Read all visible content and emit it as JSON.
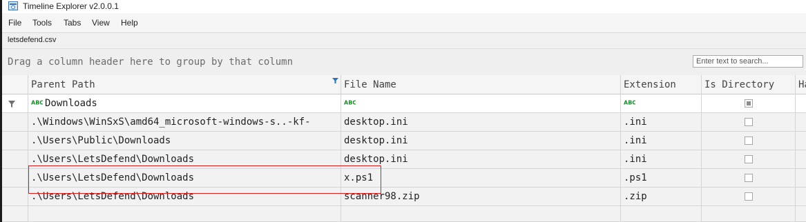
{
  "window": {
    "title": "Timeline Explorer v2.0.0.1",
    "icon": "timeline-app-icon"
  },
  "menu": [
    "File",
    "Tools",
    "Tabs",
    "View",
    "Help"
  ],
  "file_tab": "letsdefend.csv",
  "group_panel": {
    "hint": "Drag a column header here to group by that column",
    "search_placeholder": "Enter text to search..."
  },
  "grid": {
    "columns": [
      "Parent Path",
      "File Name",
      "Extension",
      "Is Directory",
      "Ha"
    ],
    "filter": {
      "parent_path": "Downloads",
      "file_name": "",
      "extension": "",
      "is_directory": "indeterminate"
    },
    "rows": [
      {
        "parent_path": ".\\Windows\\WinSxS\\amd64_microsoft-windows-s..-kf-",
        "file_name": "desktop.ini",
        "extension": ".ini",
        "is_directory": false
      },
      {
        "parent_path": ".\\Users\\Public\\Downloads",
        "file_name": "desktop.ini",
        "extension": ".ini",
        "is_directory": false
      },
      {
        "parent_path": ".\\Users\\LetsDefend\\Downloads",
        "file_name": "desktop.ini",
        "extension": ".ini",
        "is_directory": false
      },
      {
        "parent_path": ".\\Users\\LetsDefend\\Downloads",
        "file_name": "x.ps1",
        "extension": ".ps1",
        "is_directory": false
      },
      {
        "parent_path": ".\\Users\\LetsDefend\\Downloads",
        "file_name": "scanner98.zip",
        "extension": ".zip",
        "is_directory": false
      }
    ]
  },
  "highlight": {
    "color": "#e01b1b"
  },
  "icons": [
    "filter-funnel-icon",
    "abc-text-filter-icon",
    "sort-filter-indicator-icon"
  ]
}
